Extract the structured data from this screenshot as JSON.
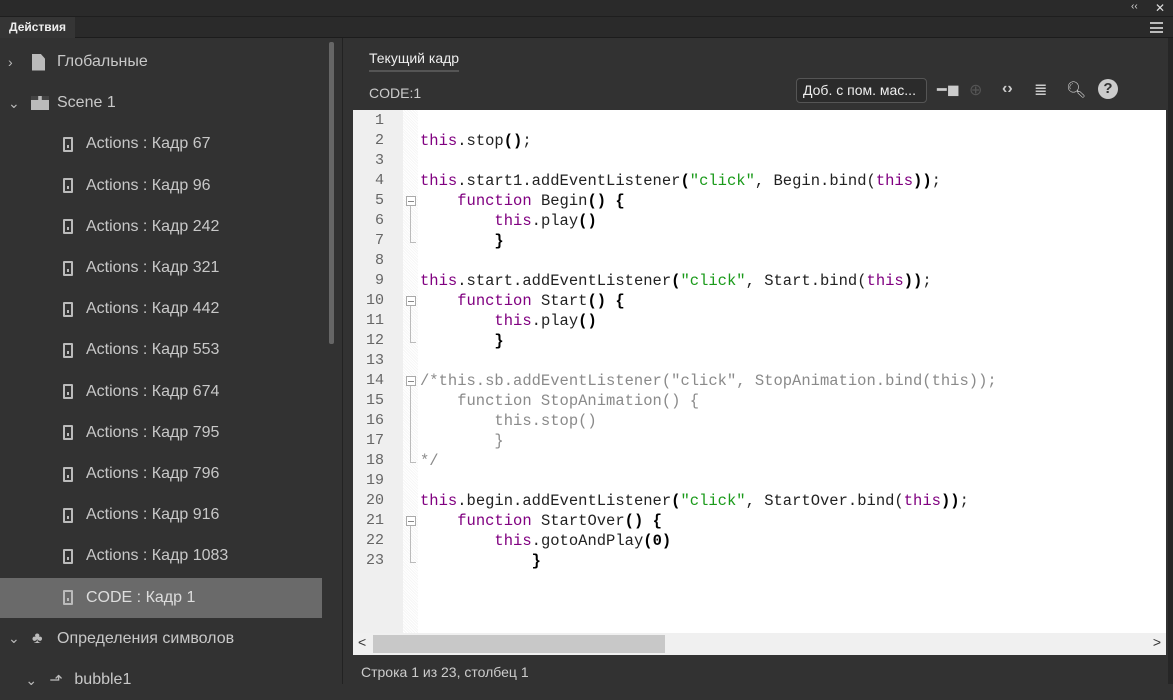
{
  "window": {
    "collapse": "‹‹",
    "close": "✕"
  },
  "panel": {
    "tab": "Действия"
  },
  "tree": [
    {
      "label": "Глобальные",
      "icon": "document-icon",
      "chev": "›",
      "level": 0
    },
    {
      "label": "Scene 1",
      "icon": "clapperboard-icon",
      "chev": "⌄",
      "level": 0
    },
    {
      "label": "Actions : Кадр 67",
      "icon": "frame-icon",
      "level": 1
    },
    {
      "label": "Actions : Кадр 96",
      "icon": "frame-icon",
      "level": 1
    },
    {
      "label": "Actions : Кадр 242",
      "icon": "frame-icon",
      "level": 1
    },
    {
      "label": "Actions : Кадр 321",
      "icon": "frame-icon",
      "level": 1
    },
    {
      "label": "Actions : Кадр 442",
      "icon": "frame-icon",
      "level": 1
    },
    {
      "label": "Actions : Кадр 553",
      "icon": "frame-icon",
      "level": 1
    },
    {
      "label": "Actions : Кадр 674",
      "icon": "frame-icon",
      "level": 1
    },
    {
      "label": "Actions : Кадр 795",
      "icon": "frame-icon",
      "level": 1
    },
    {
      "label": "Actions : Кадр 796",
      "icon": "frame-icon",
      "level": 1
    },
    {
      "label": "Actions : Кадр 916",
      "icon": "frame-icon",
      "level": 1
    },
    {
      "label": "Actions : Кадр 1083",
      "icon": "frame-icon",
      "level": 1
    },
    {
      "label": "CODE : Кадр 1",
      "icon": "frame-icon",
      "level": 1,
      "selected": true
    },
    {
      "label": "Определения символов",
      "icon": "club-icon",
      "chev": "⌄",
      "level": 0
    },
    {
      "label": "bubble1",
      "icon": "movieclip-icon",
      "chev": "⌄",
      "level": 0.6
    }
  ],
  "editor": {
    "current_tab": "Текущий кадр",
    "code_label": "CODE:1",
    "wizard_button": "Доб. с пом. мас...",
    "status": "Строка 1 из 23, столбец 1",
    "lines": [
      [],
      [
        [
          "this",
          "kw"
        ],
        [
          ".stop",
          ""
        ],
        [
          "()",
          "br"
        ],
        [
          ";",
          ""
        ]
      ],
      [],
      [
        [
          "this",
          "kw"
        ],
        [
          ".start1.addEventListener",
          ""
        ],
        [
          "(",
          "br"
        ],
        [
          "\"click\"",
          "st"
        ],
        [
          ", Begin.bind(",
          ""
        ],
        [
          "this",
          "kw"
        ],
        [
          "))",
          "br"
        ],
        [
          ";",
          ""
        ]
      ],
      [
        [
          "    ",
          ""
        ],
        [
          "function",
          "kw"
        ],
        [
          " Begin",
          ""
        ],
        [
          "()",
          "br"
        ],
        [
          " ",
          ""
        ],
        [
          "{",
          "br"
        ]
      ],
      [
        [
          "        ",
          ""
        ],
        [
          "this",
          "kw"
        ],
        [
          ".play",
          ""
        ],
        [
          "()",
          "br"
        ]
      ],
      [
        [
          "        ",
          ""
        ],
        [
          "}",
          "br"
        ]
      ],
      [],
      [
        [
          "this",
          "kw"
        ],
        [
          ".start.addEventListener",
          ""
        ],
        [
          "(",
          "br"
        ],
        [
          "\"click\"",
          "st"
        ],
        [
          ", Start.bind(",
          ""
        ],
        [
          "this",
          "kw"
        ],
        [
          "))",
          "br"
        ],
        [
          ";",
          ""
        ]
      ],
      [
        [
          "    ",
          ""
        ],
        [
          "function",
          "kw"
        ],
        [
          " Start",
          ""
        ],
        [
          "()",
          "br"
        ],
        [
          " ",
          ""
        ],
        [
          "{",
          "br"
        ]
      ],
      [
        [
          "        ",
          ""
        ],
        [
          "this",
          "kw"
        ],
        [
          ".play",
          ""
        ],
        [
          "()",
          "br"
        ]
      ],
      [
        [
          "        ",
          ""
        ],
        [
          "}",
          "br"
        ]
      ],
      [],
      [
        [
          "/*this.sb.addEventListener(\"click\", StopAnimation.bind(this));",
          "cm"
        ]
      ],
      [
        [
          "    function StopAnimation() {",
          "cm"
        ]
      ],
      [
        [
          "        this.stop()",
          "cm"
        ]
      ],
      [
        [
          "        }",
          "cm"
        ]
      ],
      [
        [
          "*/",
          "cm"
        ]
      ],
      [],
      [
        [
          "this",
          "kw"
        ],
        [
          ".begin.addEventListener",
          ""
        ],
        [
          "(",
          "br"
        ],
        [
          "\"click\"",
          "st"
        ],
        [
          ", StartOver.bind(",
          ""
        ],
        [
          "this",
          "kw"
        ],
        [
          "))",
          "br"
        ],
        [
          ";",
          ""
        ]
      ],
      [
        [
          "    ",
          ""
        ],
        [
          "function",
          "kw"
        ],
        [
          " StartOver",
          ""
        ],
        [
          "()",
          "br"
        ],
        [
          " ",
          ""
        ],
        [
          "{",
          "br"
        ]
      ],
      [
        [
          "        ",
          ""
        ],
        [
          "this",
          "kw"
        ],
        [
          ".gotoAndPlay",
          ""
        ],
        [
          "(0)",
          "br"
        ]
      ],
      [
        [
          "            ",
          ""
        ],
        [
          "}",
          "br"
        ]
      ]
    ]
  }
}
